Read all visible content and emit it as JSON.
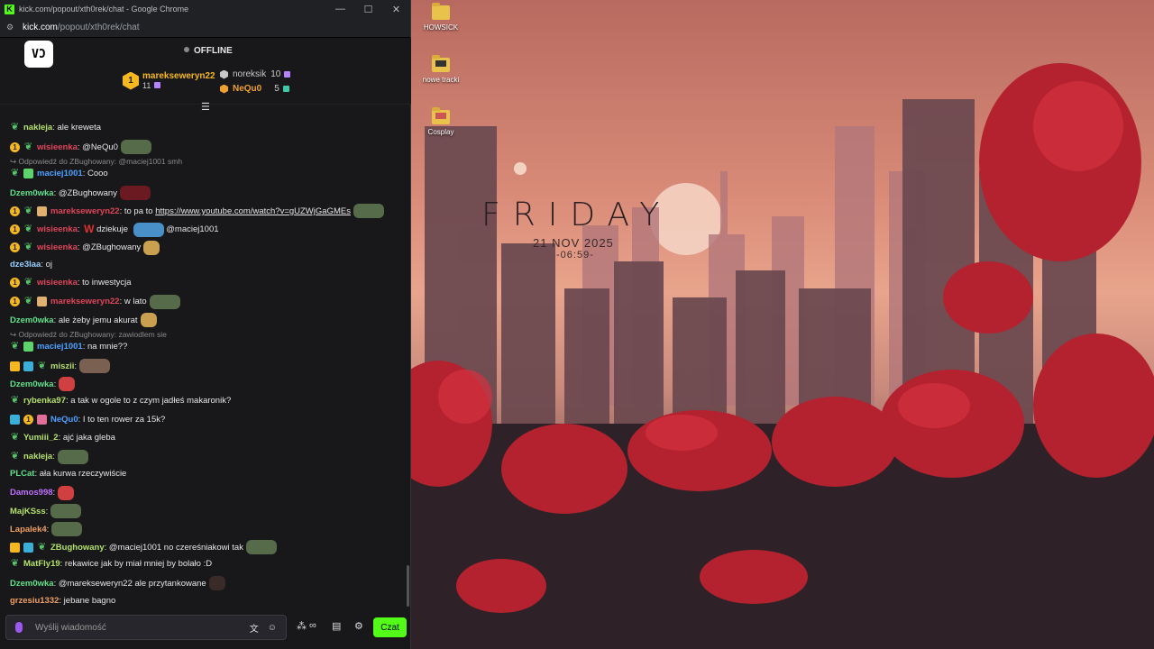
{
  "window": {
    "title": "kick.com/popout/xth0rek/chat - Google Chrome",
    "favicon": "K"
  },
  "address": {
    "host": "kick.com",
    "path": "/popout/xth0rek/chat"
  },
  "header": {
    "logo": "VƆ",
    "status": "OFFLINE",
    "top_gifters": [
      {
        "rank": "1",
        "name": "marekseweryn22",
        "count": "11",
        "color": "#f5b820"
      },
      {
        "name": "noreksik",
        "count": "10",
        "color": "#c8c8c8"
      },
      {
        "name": "NeQu0",
        "count": "5",
        "color": "#f0a030"
      }
    ]
  },
  "messages": [
    {
      "badges": [
        "leaf"
      ],
      "user": "nakleja",
      "color": "#b4e06a",
      "text": ": ale kreweta"
    },
    {
      "badges": [
        "gold",
        "leaf"
      ],
      "user": "wisieenka",
      "color": "#e0455a",
      "text": ": @NeQu0",
      "emote": "#556b4a"
    },
    {
      "reply": "↪ Odpowiedź do ZBughowany: @maciej1001 smh"
    },
    {
      "badges": [
        "leaf",
        "sub"
      ],
      "user": "maciej1001",
      "color": "#4ea1ff",
      "text": ": Cooo"
    },
    {
      "badges": [],
      "user": "Dzem0wka",
      "color": "#5fe08a",
      "text": ": @ZBughowany",
      "emote": "#6b1a22"
    },
    {
      "badges": [
        "gold",
        "leaf",
        "subtan"
      ],
      "user": "marekseweryn22",
      "color": "#e0455a",
      "text": ": to pa to ",
      "link": "https://www.youtube.com/watch?v=gUZWjGaGMEs",
      "emote": "#556b4a"
    },
    {
      "badges": [
        "gold",
        "leaf"
      ],
      "user": "wisieenka",
      "color": "#e0455a",
      "text": ": ",
      "w": "W",
      "text2": " dziekuje ",
      "emote": "#4a90c8",
      "text3": " @maciej1001"
    },
    {
      "badges": [
        "gold",
        "leaf"
      ],
      "user": "wisieenka",
      "color": "#e0455a",
      "text": ": @ZBughowany",
      "emote": "#c8a050"
    },
    {
      "badges": [],
      "user": "dze3laa",
      "color": "#9ad0ff",
      "text": ": oj"
    },
    {
      "badges": [
        "gold",
        "leaf"
      ],
      "user": "wisieenka",
      "color": "#e0455a",
      "text": ": to inwestycja"
    },
    {
      "badges": [
        "gold",
        "leaf",
        "subtan"
      ],
      "user": "marekseweryn22",
      "color": "#e0455a",
      "text": ": w lato",
      "emote": "#556b4a"
    },
    {
      "badges": [],
      "user": "Dzem0wka",
      "color": "#5fe08a",
      "text": ": ale żeby jemu akurat",
      "emote": "#c8a050"
    },
    {
      "reply": "↪ Odpowiedź do ZBughowany: zawiodlem sie"
    },
    {
      "badges": [
        "leaf",
        "sub"
      ],
      "user": "maciej1001",
      "color": "#4ea1ff",
      "text": ": na mnie??"
    },
    {
      "badges": [
        "crown",
        "vip",
        "leaf"
      ],
      "user": "miszii",
      "color": "#b4e06a",
      "text": ":",
      "emote": "#7a6050"
    },
    {
      "badges": [],
      "user": "Dzem0wka",
      "color": "#5fe08a",
      "text": ":",
      "emote": "#d04040"
    },
    {
      "badges": [
        "leaf"
      ],
      "user": "rybenka97",
      "color": "#b4e06a",
      "text": ": a tak w ogole to z czym jadłeś makaronik?"
    },
    {
      "badges": [
        "vip",
        "gold",
        "subpink"
      ],
      "user": "NeQu0",
      "color": "#4ea1ff",
      "text": ": I to ten rower za 15k?"
    },
    {
      "badges": [
        "leaf"
      ],
      "user": "Yumiii_2",
      "color": "#b4e06a",
      "text": ": ajć jaka gleba"
    },
    {
      "badges": [
        "leaf"
      ],
      "user": "nakleja",
      "color": "#b4e06a",
      "text": ":",
      "emote": "#556b4a"
    },
    {
      "badges": [],
      "user": "PLCat",
      "color": "#5fe08a",
      "text": ": ała kurwa rzeczywiście"
    },
    {
      "badges": [],
      "user": "Damos998",
      "color": "#c070ff",
      "text": ":",
      "emote": "#d04040"
    },
    {
      "badges": [],
      "user": "MajKSss",
      "color": "#b4e06a",
      "text": ":",
      "emote": "#556b4a"
    },
    {
      "badges": [],
      "user": "Lapalek4",
      "color": "#f0a060",
      "text": ":",
      "emote": "#556b4a"
    },
    {
      "badges": [
        "crown",
        "vip",
        "leaf"
      ],
      "user": "ZBughowany",
      "color": "#b4e06a",
      "text": ": @maciej1001 no czereśniakowi tak",
      "emote": "#556b4a"
    },
    {
      "badges": [
        "leaf"
      ],
      "user": "MatFly19",
      "color": "#b4e06a",
      "text": ": rekawice jak by miał mniej by bolało :D"
    },
    {
      "badges": [],
      "user": "Dzem0wka",
      "color": "#5fe08a",
      "text": ": @marekseweryn22 ale przytankowane",
      "emote": "#3a2a28"
    },
    {
      "badges": [],
      "user": "grzesiu1332",
      "color": "#f0a060",
      "text": ": jebane bagno"
    }
  ],
  "composer": {
    "placeholder": "Wyślij wiadomość",
    "send_label": "Czat"
  },
  "desktop": {
    "icons": [
      {
        "label": "HOWSICK"
      },
      {
        "label": "nowe tracki"
      },
      {
        "label": "Cosplay"
      }
    ],
    "clock": {
      "day": "FRIDAY",
      "date": "21 NOV 2025",
      "time": "-06:59-"
    }
  }
}
